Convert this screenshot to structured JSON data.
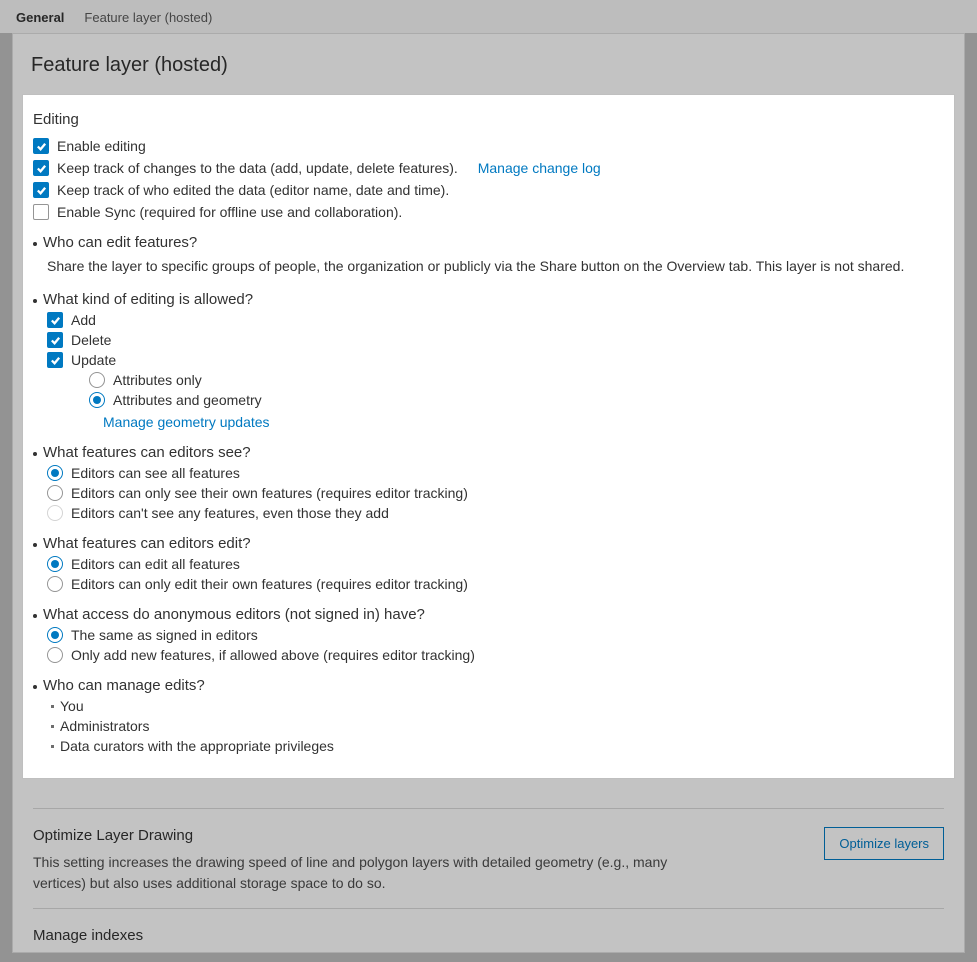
{
  "tabs": {
    "general": "General",
    "feature": "Feature layer (hosted)"
  },
  "panel_title": "Feature layer (hosted)",
  "editing": {
    "heading": "Editing",
    "enable": "Enable editing",
    "track_changes": "Keep track of changes to the data (add, update, delete features).",
    "manage_change_log": "Manage change log",
    "track_who": "Keep track of who edited the data (editor name, date and time).",
    "enable_sync": "Enable Sync (required for offline use and collaboration).",
    "who_edit_q": "Who can edit features?",
    "who_edit_a": "Share the layer to specific groups of people, the organization or publicly via the Share button on the Overview tab. This layer is not shared.",
    "kind_q": "What kind of editing is allowed?",
    "kind_add": "Add",
    "kind_delete": "Delete",
    "kind_update": "Update",
    "update_attr_only": "Attributes only",
    "update_attr_geom": "Attributes and geometry",
    "manage_geom": "Manage geometry updates",
    "see_q": "What features can editors see?",
    "see_all": "Editors can see all features",
    "see_own": "Editors can only see their own features (requires editor tracking)",
    "see_none": "Editors can't see any features, even those they add",
    "edit_q": "What features can editors edit?",
    "edit_all": "Editors can edit all features",
    "edit_own": "Editors can only edit their own features (requires editor tracking)",
    "anon_q": "What access do anonymous editors (not signed in) have?",
    "anon_same": "The same as signed in editors",
    "anon_add": "Only add new features, if allowed above (requires editor tracking)",
    "manage_q": "Who can manage edits?",
    "manage_you": "You",
    "manage_admins": "Administrators",
    "manage_curators": "Data curators with the appropriate privileges"
  },
  "optimize": {
    "heading": "Optimize Layer Drawing",
    "desc": "This setting increases the drawing speed of line and polygon layers with detailed geometry (e.g., many vertices) but also uses additional storage space to do so.",
    "button": "Optimize layers"
  },
  "indexes": {
    "heading": "Manage indexes"
  }
}
